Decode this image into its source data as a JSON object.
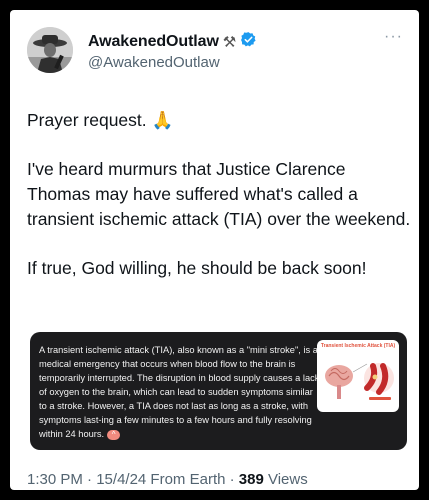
{
  "tweet": {
    "display_name": "AwakenedOutlaw",
    "handle": "@AwakenedOutlaw",
    "more_icon": "···",
    "paragraphs": [
      "Prayer request. 🙏",
      "I've heard murmurs that Justice Clarence Thomas may have suffered what's called a transient ischemic attack (TIA) over the weekend.",
      "If true, God willing, he should be back soon!"
    ],
    "verified_color": "#1d9bf0",
    "name_emoji": "⚒"
  },
  "media": {
    "text": "A transient ischemic attack (TIA), also known as a \"mini stroke\", is a medical emergency that occurs when blood flow to the brain is temporarily interrupted. The disruption in blood supply causes a lack of oxygen to the brain, which can lead to sudden symptoms similar to a stroke. However, a TIA does not last as long as a stroke, with symptoms last-ing a few minutes to a few hours and fully resolving within 24 hours.",
    "caret_icon": "^",
    "diagram_title": "Transient Ischemic Attack (TIA)"
  },
  "footer": {
    "time": "1:30 PM",
    "sep1": " · ",
    "date": "15/4/24",
    "source": " From Earth",
    "sep2": " · ",
    "views_count": "389",
    "views_label": " Views"
  }
}
